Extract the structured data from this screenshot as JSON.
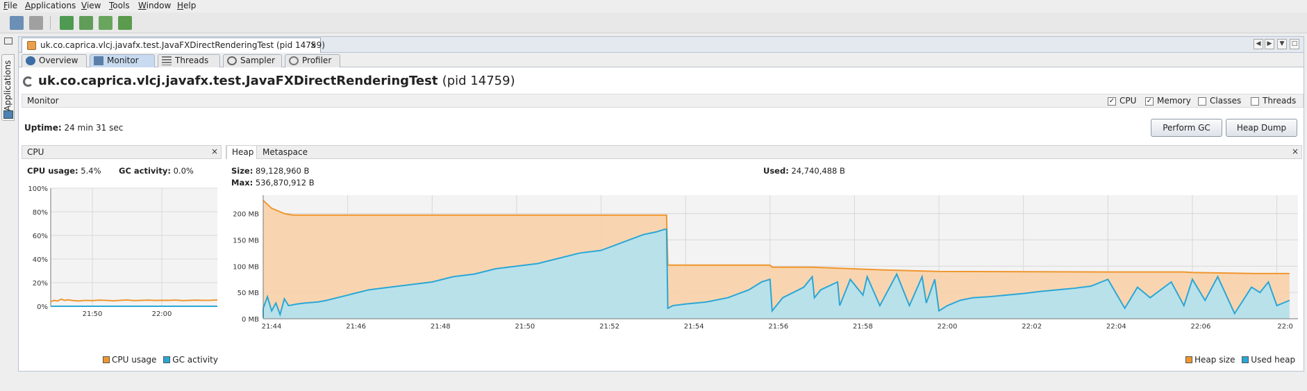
{
  "menubar": {
    "items": [
      "File",
      "Applications",
      "View",
      "Tools",
      "Window",
      "Help"
    ]
  },
  "sidebar": {
    "applications_label": "Applications"
  },
  "document_tab": {
    "label": "uk.co.caprica.vlcj.javafx.test.JavaFXDirectRenderingTest (pid 14759)",
    "close": "×"
  },
  "subtabs": [
    {
      "label": "Overview",
      "icon": "info-icon"
    },
    {
      "label": "Monitor",
      "icon": "monitor-icon",
      "active": true
    },
    {
      "label": "Threads",
      "icon": "threads-icon"
    },
    {
      "label": "Sampler",
      "icon": "sampler-icon"
    },
    {
      "label": "Profiler",
      "icon": "profiler-icon"
    }
  ],
  "header": {
    "title": "uk.co.caprica.vlcj.javafx.test.JavaFXDirectRenderingTest",
    "pid": "(pid 14759)"
  },
  "monitor": {
    "title": "Monitor",
    "checkboxes": [
      {
        "label": "CPU",
        "checked": true,
        "mark": "✓"
      },
      {
        "label": "Memory",
        "checked": true,
        "mark": "✓"
      },
      {
        "label": "Classes",
        "checked": false,
        "mark": ""
      },
      {
        "label": "Threads",
        "checked": false,
        "mark": ""
      }
    ],
    "uptime_label": "Uptime:",
    "uptime_value": "24 min 31 sec",
    "perform_gc": "Perform GC",
    "heap_dump": "Heap Dump"
  },
  "cpu_panel": {
    "title": "CPU",
    "close": "×",
    "usage_label": "CPU usage:",
    "usage_value": "5.4%",
    "gc_label": "GC activity:",
    "gc_value": "0.0%",
    "legend": [
      {
        "label": "CPU usage",
        "color": "#f0962e"
      },
      {
        "label": "GC activity",
        "color": "#2aa6d6"
      }
    ]
  },
  "heap_panel": {
    "tabs": [
      "Heap",
      "Metaspace"
    ],
    "close": "×",
    "size_label": "Size:",
    "size_value": "89,128,960 B",
    "max_label": "Max:",
    "max_value": "536,870,912 B",
    "used_label": "Used:",
    "used_value": "24,740,488 B",
    "legend": [
      {
        "label": "Heap size",
        "color": "#f0962e"
      },
      {
        "label": "Used heap",
        "color": "#2aa6d6"
      }
    ]
  },
  "chart_data": [
    {
      "type": "line",
      "name_ref": "cpu",
      "y_ticks": [
        "100%",
        "80%",
        "60%",
        "40%",
        "20%",
        "0%"
      ],
      "ylim": [
        0,
        100
      ],
      "x_ticks": [
        {
          "label": "21:50",
          "t": 6
        },
        {
          "label": "22:00",
          "t": 16
        }
      ],
      "xlim": [
        0,
        24
      ],
      "series": [
        {
          "name": "CPU usage",
          "color": "#f0962e",
          "x": [
            0,
            0.5,
            1,
            1.5,
            2,
            2.5,
            3,
            4,
            5,
            6,
            7,
            8,
            9,
            10,
            11,
            12,
            13,
            14,
            15,
            16,
            17,
            18,
            19,
            20,
            21,
            22,
            23,
            24
          ],
          "values": [
            4,
            5,
            4.5,
            6,
            5,
            5.5,
            5,
            4.5,
            5,
            4.8,
            5.2,
            5,
            4.6,
            5,
            5.4,
            4.8,
            5,
            5.2,
            4.9,
            5.1,
            5,
            5.3,
            4.8,
            5,
            5.2,
            5,
            5.1,
            5.4
          ]
        },
        {
          "name": "GC activity",
          "color": "#2aa6d6",
          "x": [
            0,
            24
          ],
          "values": [
            0,
            0
          ]
        }
      ]
    },
    {
      "type": "area",
      "name_ref": "heap",
      "y_ticks": [
        {
          "label": "0 MB",
          "v": 0
        },
        {
          "label": "50 MB",
          "v": 50
        },
        {
          "label": "100 MB",
          "v": 100
        },
        {
          "label": "150 MB",
          "v": 150
        },
        {
          "label": "200 MB",
          "v": 200
        }
      ],
      "ylim": [
        0,
        235
      ],
      "xlim": [
        0,
        24.5
      ],
      "x_ticks": [
        {
          "label": "21:44",
          "t": 0
        },
        {
          "label": "21:46",
          "t": 2
        },
        {
          "label": "21:48",
          "t": 4
        },
        {
          "label": "21:50",
          "t": 6
        },
        {
          "label": "21:52",
          "t": 8
        },
        {
          "label": "21:54",
          "t": 10
        },
        {
          "label": "21:56",
          "t": 12
        },
        {
          "label": "21:58",
          "t": 14
        },
        {
          "label": "22:00",
          "t": 16
        },
        {
          "label": "22:02",
          "t": 18
        },
        {
          "label": "22:04",
          "t": 20
        },
        {
          "label": "22:06",
          "t": 22
        },
        {
          "label": "22:0",
          "t": 24
        }
      ],
      "series": [
        {
          "name": "Heap size",
          "color": "#f0962e",
          "fill": "#f8d2a8",
          "x": [
            -0.2,
            0.2,
            0.5,
            0.7,
            1.0,
            9.55,
            9.58,
            12.0,
            12.05,
            13.0,
            14.6,
            16.0,
            20.0,
            21.8,
            22.0,
            23.5,
            24.3
          ],
          "values": [
            225,
            210,
            200,
            197,
            197,
            197,
            102,
            102,
            98,
            98,
            93,
            90,
            89,
            89,
            88,
            86,
            86
          ]
        },
        {
          "name": "Used heap",
          "color": "#2aa6d6",
          "fill": "#aee3f5",
          "x": [
            -0.2,
            0,
            0.1,
            0.2,
            0.3,
            0.4,
            0.5,
            0.6,
            0.8,
            1,
            1.3,
            1.5,
            2,
            2.5,
            3,
            3.5,
            4,
            4.5,
            5,
            5.5,
            6,
            6.5,
            7,
            7.5,
            8,
            8.5,
            9,
            9.3,
            9.5,
            9.55,
            9.58,
            9.7,
            10,
            10.5,
            11,
            11.5,
            11.8,
            12.0,
            12.05,
            12.3,
            12.8,
            13.0,
            13.05,
            13.2,
            13.6,
            13.65,
            13.9,
            14.2,
            14.3,
            14.6,
            14.9,
            15.0,
            15.3,
            15.6,
            15.7,
            15.9,
            16.0,
            16.2,
            16.5,
            16.8,
            17.2,
            17.6,
            18.0,
            18.4,
            18.8,
            19.2,
            19.6,
            20.0,
            20.4,
            20.7,
            21.0,
            21.5,
            21.8,
            22.0,
            22.3,
            22.6,
            23.0,
            23.4,
            23.6,
            23.8,
            24.0,
            24.3
          ],
          "values": [
            2,
            20,
            42,
            15,
            30,
            8,
            38,
            25,
            28,
            30,
            32,
            35,
            45,
            55,
            60,
            65,
            70,
            80,
            85,
            95,
            100,
            105,
            115,
            125,
            130,
            145,
            160,
            165,
            170,
            170,
            20,
            25,
            28,
            32,
            40,
            55,
            70,
            75,
            15,
            40,
            60,
            80,
            40,
            55,
            70,
            25,
            75,
            45,
            80,
            25,
            70,
            85,
            25,
            80,
            30,
            75,
            15,
            25,
            35,
            40,
            42,
            45,
            48,
            52,
            55,
            58,
            62,
            75,
            20,
            60,
            40,
            70,
            25,
            75,
            35,
            80,
            10,
            60,
            50,
            70,
            25,
            35
          ]
        }
      ]
    }
  ]
}
